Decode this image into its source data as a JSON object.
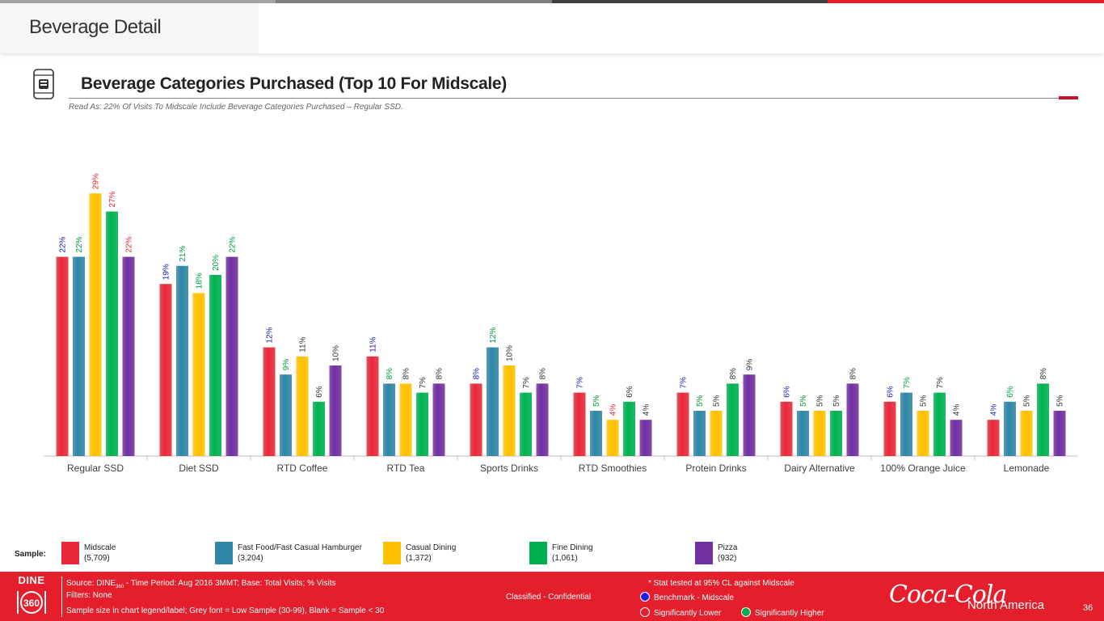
{
  "header": {
    "title": "Beverage Detail"
  },
  "section": {
    "title": "Beverage Categories Purchased (Top 10 For Midscale)",
    "read_as": "Read As: 22% Of Visits To Midscale Include Beverage Categories Purchased – Regular SSD."
  },
  "colors": {
    "midscale": "#e8283a",
    "ff_hamburger": "#2f86a6",
    "casual_dining": "#ffc000",
    "fine_dining": "#00b050",
    "pizza": "#7030a0",
    "benchmark_text": "#2020c0",
    "higher_text": "#00a040",
    "lower_text": "#e8283a",
    "footer_red": "#e41e2b"
  },
  "chart_data": {
    "type": "bar",
    "categories": [
      "Regular SSD",
      "Diet SSD",
      "RTD Coffee",
      "RTD Tea",
      "Sports Drinks",
      "RTD Smoothies",
      "Protein Drinks",
      "Dairy Alternative",
      "100% Orange Juice",
      "Lemonade"
    ],
    "ylim": [
      0,
      31
    ],
    "grid": false,
    "series": [
      {
        "name": "Midscale",
        "values": [
          22,
          19,
          12,
          11,
          8,
          7,
          7,
          6,
          6,
          4
        ],
        "labels": [
          "22%",
          "19%",
          "12%",
          "11%",
          "8%",
          "7%",
          "7%",
          "6%",
          "6%",
          "4%"
        ],
        "label_status": [
          "benchmark",
          "benchmark",
          "benchmark",
          "benchmark",
          "benchmark",
          "benchmark",
          "benchmark",
          "benchmark",
          "benchmark",
          "benchmark"
        ]
      },
      {
        "name": "Fast Food/Fast Casual Hamburger",
        "values": [
          22,
          21,
          9,
          8,
          12,
          5,
          5,
          5,
          7,
          6
        ],
        "labels": [
          "22%",
          "21%",
          "9%",
          "8%",
          "12%",
          "5%",
          "5%",
          "5%",
          "7%",
          "6%"
        ],
        "label_status": [
          "higher",
          "higher",
          "higher",
          "higher",
          "higher",
          "higher",
          "higher",
          "higher",
          "higher",
          "higher"
        ]
      },
      {
        "name": "Casual Dining",
        "values": [
          29,
          18,
          11,
          8,
          10,
          4,
          5,
          5,
          5,
          5
        ],
        "labels": [
          "29%",
          "18%",
          "11%",
          "8%",
          "10%",
          "4%",
          "5%",
          "5%",
          "5%",
          "5%"
        ],
        "label_status": [
          "lower",
          "higher",
          "normal",
          "normal",
          "normal",
          "lower",
          "normal",
          "normal",
          "normal",
          "normal"
        ]
      },
      {
        "name": "Fine Dining",
        "values": [
          27,
          20,
          6,
          7,
          7,
          6,
          8,
          5,
          7,
          8
        ],
        "labels": [
          "27%",
          "20%",
          "6%",
          "7%",
          "7%",
          "6%",
          "8%",
          "5%",
          "7%",
          "8%"
        ],
        "label_status": [
          "lower",
          "higher",
          "normal",
          "normal",
          "normal",
          "normal",
          "normal",
          "normal",
          "normal",
          "normal"
        ]
      },
      {
        "name": "Pizza",
        "values": [
          22,
          22,
          10,
          8,
          8,
          4,
          9,
          8,
          4,
          5
        ],
        "labels": [
          "22%",
          "22%",
          "10%",
          "8%",
          "8%",
          "4%",
          "9%",
          "8%",
          "4%",
          "5%"
        ],
        "label_status": [
          "lower",
          "higher",
          "normal",
          "normal",
          "normal",
          "normal",
          "normal",
          "normal",
          "normal",
          "normal"
        ]
      }
    ]
  },
  "legend": {
    "sample_label": "Sample:",
    "items": [
      {
        "name": "Midscale",
        "n": "(5,709)"
      },
      {
        "name": "Fast Food/Fast Casual Hamburger",
        "n": "(3,204)"
      },
      {
        "name": "Casual Dining",
        "n": "(1,372)"
      },
      {
        "name": "Fine Dining",
        "n": "(1,061)"
      },
      {
        "name": "Pizza",
        "n": "(932)"
      }
    ]
  },
  "footer": {
    "logo_text": "DINE",
    "logo_number": "360",
    "source_prefix": "Source: DINE",
    "source_sub": "360",
    "source_rest": " - Time Period: Aug 2016 3MMT; Base: Total Visits; % Visits",
    "filters": "Filters: None",
    "sample_note": "Sample size in chart legend/label;  Grey font = Low Sample (30-99), Blank = Sample < 30",
    "classification": "Classified - Confidential",
    "stat_note": "* Stat tested at 95% CL against Midscale",
    "benchmark": "Benchmark - Midscale",
    "lower": "Significantly Lower",
    "higher": "Significantly Higher",
    "brand": "Coca-Cola",
    "region": "North America",
    "page_number": "36"
  }
}
